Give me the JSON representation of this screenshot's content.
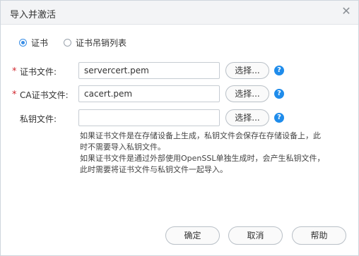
{
  "dialog": {
    "title": "导入并激活",
    "close_icon": "close-icon"
  },
  "mode": {
    "options": [
      {
        "label": "证书",
        "selected": true
      },
      {
        "label": "证书吊销列表",
        "selected": false
      }
    ]
  },
  "fields": [
    {
      "label": "证书文件:",
      "required": true,
      "value": "servercert.pem",
      "browse_label": "选择...",
      "help": "?"
    },
    {
      "label": "CA证书文件:",
      "required": true,
      "value": "cacert.pem",
      "browse_label": "选择...",
      "help": "?"
    },
    {
      "label": "私钥文件:",
      "required": false,
      "value": "",
      "browse_label": "选择...",
      "help": "?"
    }
  ],
  "required_mark": "*",
  "note": {
    "lines": [
      "如果证书文件是在存储设备上生成，私钥文件会保存在存储设备上，此",
      "时不需要导入私钥文件。",
      "如果证书文件是通过外部使用OpenSSL单独生成时，会产生私钥文件，",
      "此时需要将证书文件与私钥文件一起导入。"
    ]
  },
  "buttons": {
    "ok": "确定",
    "cancel": "取消",
    "help": "帮助"
  },
  "colors": {
    "accent": "#3a8ee6",
    "help_icon": "#1f8ceb",
    "required": "#d0262d",
    "titlebar": "#f3f4f6"
  }
}
